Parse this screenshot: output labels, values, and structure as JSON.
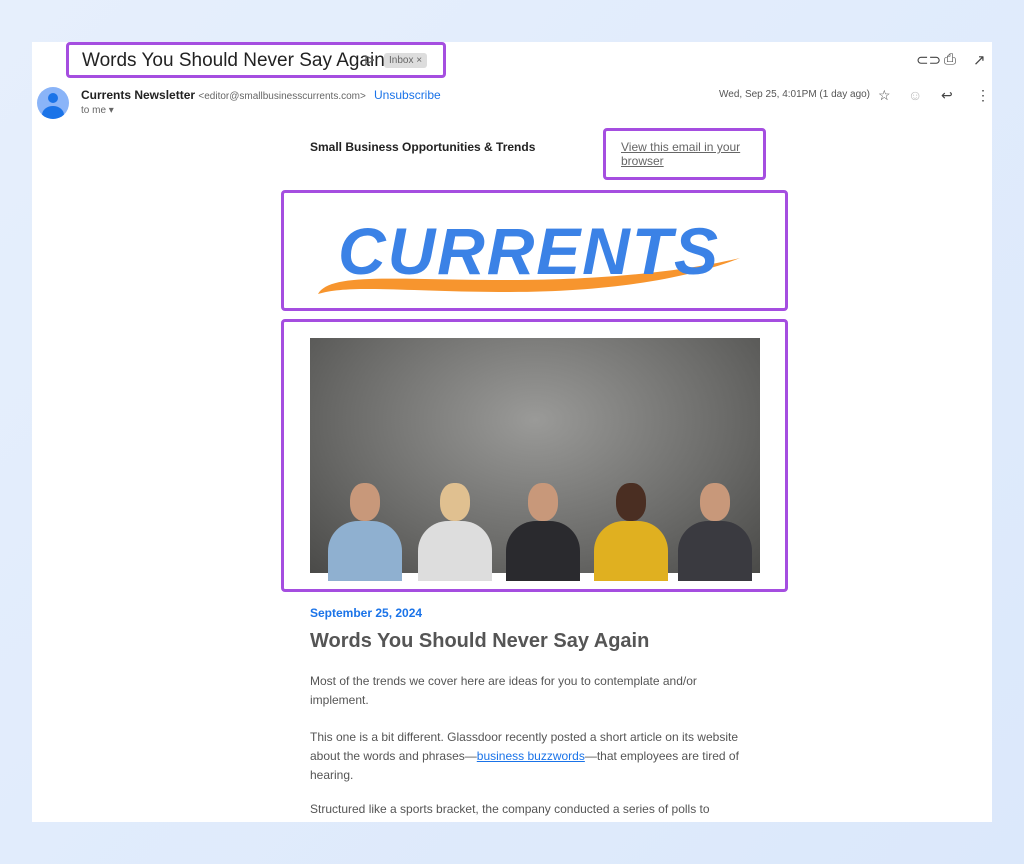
{
  "header": {
    "subject": "Words You Should Never Say Again",
    "label": "Inbox",
    "label_close": "×",
    "icons": [
      "link-icon",
      "print-icon",
      "open-in-new-icon"
    ]
  },
  "message": {
    "sender_name": "Currents Newsletter",
    "sender_email": "<editor@smallbusinesscurrents.com>",
    "unsubscribe": "Unsubscribe",
    "recipient": "to me",
    "date": "Wed, Sep 25, 4:01PM (1 day ago)"
  },
  "email": {
    "preheader": "Small Business Opportunities & Trends",
    "view_in_browser": "View this email in your browser",
    "logo_text": "CURRENTS",
    "date": "September 25, 2024",
    "title": "Words You Should Never Say Again",
    "p1": "Most of the trends we cover here are ideas for you to contemplate and/or implement.",
    "p2_before": "This one is a bit different. Glassdoor recently posted a short article on its website about the words and phrases—",
    "p2_link": "business buzzwords",
    "p2_after": "—that employees are tired of hearing.",
    "p3": "Structured like a sports bracket, the company conducted a series of polls to"
  },
  "colors": {
    "accent": "#1a73e8",
    "highlight": "#a54ee0",
    "logo_blue": "#3b82e6",
    "logo_orange": "#f7952e"
  }
}
